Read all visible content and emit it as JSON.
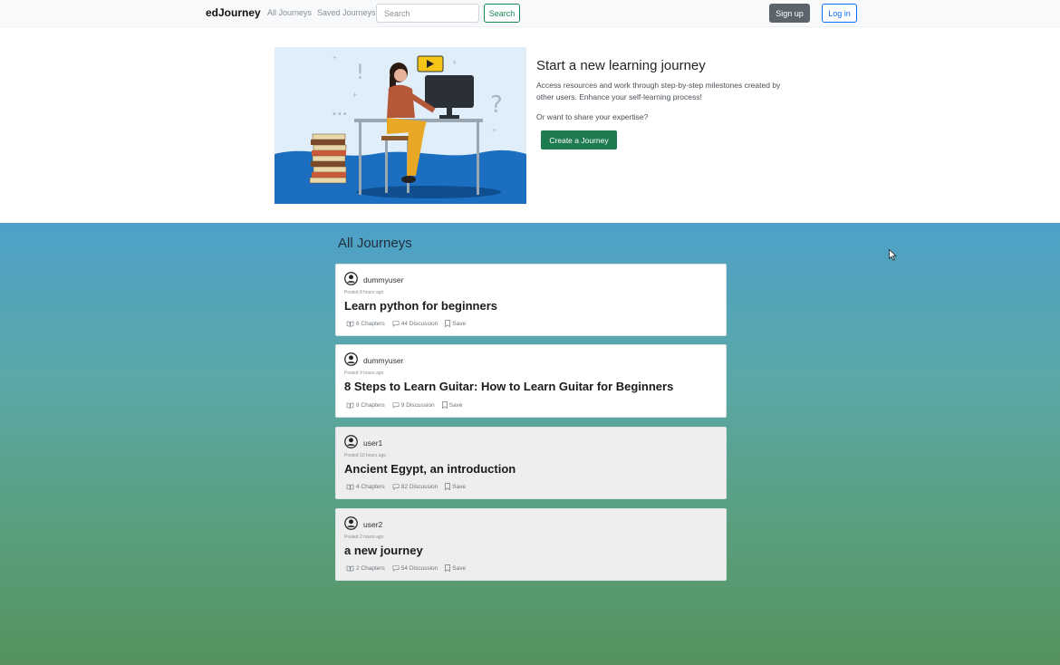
{
  "navbar": {
    "brand": "edJourney",
    "links": [
      "All Journeys",
      "Saved Journeys"
    ],
    "search_placeholder": "Search",
    "search_button": "Search",
    "signup": "Sign up",
    "login": "Log in"
  },
  "hero": {
    "title": "Start a new learning journey",
    "description": "Access resources and work through step-by-step milestones created by other users. Enhance your self-learning process!",
    "share_prompt": "Or want to share your expertise?",
    "create_button": "Create a Journey"
  },
  "journeys": {
    "title": "All Journeys",
    "items": [
      {
        "user": "dummyuser",
        "posted": "Posted 8 hours ago",
        "title": "Learn python for beginners",
        "chapters": "6 Chapters",
        "discussion": "44 Discussion",
        "save": "Save"
      },
      {
        "user": "dummyuser",
        "posted": "Posted 9 hours ago",
        "title": "8 Steps to Learn Guitar: How to Learn Guitar for Beginners",
        "chapters": "8 Chapters",
        "discussion": "9 Discussion",
        "save": "Save"
      },
      {
        "user": "user1",
        "posted": "Posted 10 hours ago",
        "title": "Ancient Egypt, an introduction",
        "chapters": "4 Chapters",
        "discussion": "82 Discussion",
        "save": "Save"
      },
      {
        "user": "user2",
        "posted": "Posted 2 hours ago",
        "title": "a new journey",
        "chapters": "2 Chapters",
        "discussion": "54 Discussion",
        "save": "Save"
      }
    ]
  },
  "colors": {
    "accent_green": "#1e7a4f",
    "link_blue": "#0d6efd",
    "signup_gray": "#5c636a"
  }
}
